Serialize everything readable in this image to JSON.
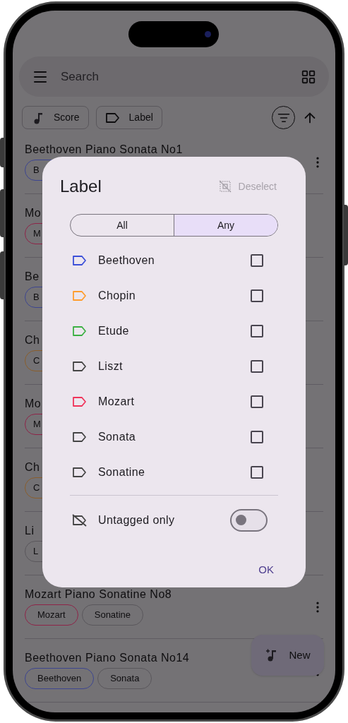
{
  "search": {
    "placeholder": "Search"
  },
  "filters": [
    {
      "label": "Score",
      "kind": "score"
    },
    {
      "label": "Label",
      "kind": "label"
    }
  ],
  "scores": [
    {
      "kind": "top",
      "title": "Beethoven Piano Sonata No1",
      "labels": [
        {
          "text": "B",
          "color": "#3d4590"
        }
      ]
    },
    {
      "kind": "covered",
      "title": "Mo",
      "labels": [
        {
          "text": "M",
          "color": "#8e2448"
        }
      ]
    },
    {
      "kind": "covered",
      "title": "Be",
      "labels": [
        {
          "text": "B",
          "color": "#3d4590"
        }
      ]
    },
    {
      "kind": "covered",
      "title": "Ch",
      "labels": [
        {
          "text": "C",
          "color": "#8a5e2c"
        }
      ]
    },
    {
      "kind": "covered",
      "title": "Mo",
      "labels": [
        {
          "text": "M",
          "color": "#8e2448"
        }
      ]
    },
    {
      "kind": "covered",
      "title": "Ch",
      "labels": [
        {
          "text": "C",
          "color": "#8a5e2c"
        }
      ]
    },
    {
      "kind": "covered",
      "title": "Li",
      "labels": [
        {
          "text": "L",
          "color": "#5a575c"
        }
      ]
    },
    {
      "kind": "full",
      "title": "Mozart Piano Sonatine No8",
      "labels": [
        {
          "text": "Mozart",
          "color": "#8e2448"
        },
        {
          "text": "Sonatine",
          "color": "#5a575c"
        }
      ]
    },
    {
      "kind": "full",
      "title": "Beethoven Piano Sonata No14",
      "labels": [
        {
          "text": "Beethoven",
          "color": "#3d4590"
        },
        {
          "text": "Sonata",
          "color": "#5a575c"
        }
      ]
    }
  ],
  "fab": {
    "label": "New"
  },
  "dialog": {
    "title": "Label",
    "deselect": {
      "label": "Deselect",
      "disabled": true
    },
    "modes": [
      {
        "label": "All",
        "selected": false
      },
      {
        "label": "Any",
        "selected": true
      }
    ],
    "labels": [
      {
        "name": "Beethoven",
        "color": "#3b4fd8",
        "checked": false
      },
      {
        "name": "Chopin",
        "color": "#ff9d2e",
        "checked": false
      },
      {
        "name": "Etude",
        "color": "#3cb043",
        "checked": false
      },
      {
        "name": "Liszt",
        "color": "#444444",
        "checked": false
      },
      {
        "name": "Mozart",
        "color": "#f0345a",
        "checked": false
      },
      {
        "name": "Sonata",
        "color": "#444444",
        "checked": false
      },
      {
        "name": "Sonatine",
        "color": "#444444",
        "checked": false
      }
    ],
    "untagged": {
      "label": "Untagged only",
      "on": false
    },
    "ok": "OK"
  }
}
